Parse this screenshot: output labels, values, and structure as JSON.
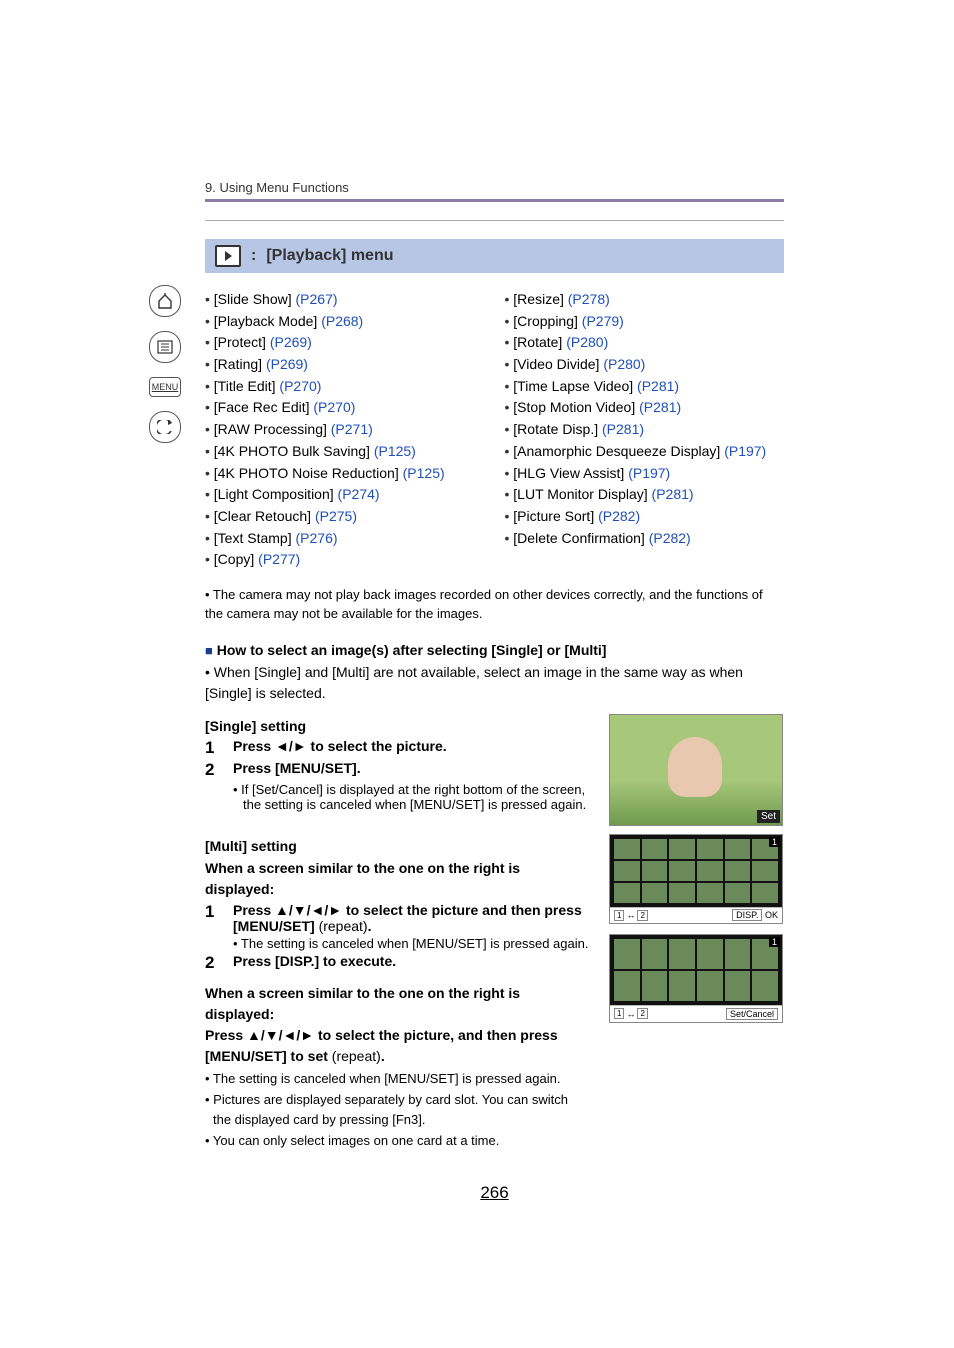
{
  "breadcrumb": "9. Using Menu Functions",
  "section": {
    "title_suffix": "[Playback] menu",
    "title_sep": ":"
  },
  "menu_col1": [
    {
      "label": "[Slide Show]",
      "ref": "(P267)"
    },
    {
      "label": "[Playback Mode]",
      "ref": "(P268)"
    },
    {
      "label": "[Protect]",
      "ref": "(P269)"
    },
    {
      "label": "[Rating]",
      "ref": "(P269)"
    },
    {
      "label": "[Title Edit]",
      "ref": "(P270)"
    },
    {
      "label": "[Face Rec Edit]",
      "ref": "(P270)"
    },
    {
      "label": "[RAW Processing]",
      "ref": "(P271)"
    },
    {
      "label": "[4K PHOTO Bulk Saving]",
      "ref": "(P125)"
    },
    {
      "label": "[4K PHOTO Noise Reduction]",
      "ref": "(P125)"
    },
    {
      "label": "[Light Composition]",
      "ref": "(P274)"
    },
    {
      "label": "[Clear Retouch]",
      "ref": "(P275)"
    },
    {
      "label": "[Text Stamp]",
      "ref": "(P276)"
    },
    {
      "label": "[Copy]",
      "ref": "(P277)"
    }
  ],
  "menu_col2": [
    {
      "label": "[Resize]",
      "ref": "(P278)"
    },
    {
      "label": "[Cropping]",
      "ref": "(P279)"
    },
    {
      "label": "[Rotate]",
      "ref": "(P280)"
    },
    {
      "label": "[Video Divide]",
      "ref": "(P280)"
    },
    {
      "label": "[Time Lapse Video]",
      "ref": "(P281)"
    },
    {
      "label": "[Stop Motion Video]",
      "ref": "(P281)"
    },
    {
      "label": "[Rotate Disp.]",
      "ref": "(P281)"
    },
    {
      "label": "[Anamorphic Desqueeze Display]",
      "ref": "(P197)"
    },
    {
      "label": "[HLG View Assist]",
      "ref": "(P197)"
    },
    {
      "label": "[LUT Monitor Display]",
      "ref": "(P281)"
    },
    {
      "label": "[Picture Sort]",
      "ref": "(P282)"
    },
    {
      "label": "[Delete Confirmation]",
      "ref": "(P282)"
    }
  ],
  "note1": "• The camera may not play back images recorded on other devices correctly, and the functions of the camera may not be available for the images.",
  "howto_head": "How to select an image(s) after selecting [Single] or [Multi]",
  "howto_body": "• When [Single] and [Multi] are not available, select an image in the same way as when [Single] is selected.",
  "single": {
    "head": "[Single] setting",
    "step1": "Press ◄/► to select the picture.",
    "step2": "Press [MENU/SET].",
    "sub": "• If [Set/Cancel] is displayed at the right bottom of the screen, the setting is canceled when [MENU/SET] is pressed again.",
    "img_label": "Set"
  },
  "multi": {
    "head": "[Multi] setting",
    "intro1": "When a screen similar to the one on the right is displayed:",
    "step1a": "Press ▲/▼/◄/► to select the picture and then press [MENU/SET] ",
    "step1b": "(repeat)",
    "step1c": ".",
    "sub1": "• The setting is canceled when [MENU/SET] is pressed again.",
    "step2": "Press [DISP.] to execute.",
    "intro2": "When a screen similar to the one on the right is displayed:",
    "press_a": "Press ▲/▼/◄/► to select the picture, and then press [MENU/SET] to set ",
    "press_b": "(repeat)",
    "press_c": ".",
    "b1": "• The setting is canceled when [MENU/SET] is pressed again.",
    "b2": "• Pictures are displayed separately by card slot. You can switch the displayed card by pressing [Fn3].",
    "b3": "• You can only select images on one card at a time.",
    "img2": {
      "left": "1↔2",
      "right_pre": "DISP.",
      "right": "OK",
      "corner": "1"
    },
    "img3": {
      "left": "1↔2",
      "right": "Set/Cancel",
      "corner": "1"
    }
  },
  "nums": {
    "n1": "1",
    "n2": "2"
  },
  "sidebar": {
    "menu": "MENU"
  },
  "square": "■",
  "page": "266"
}
